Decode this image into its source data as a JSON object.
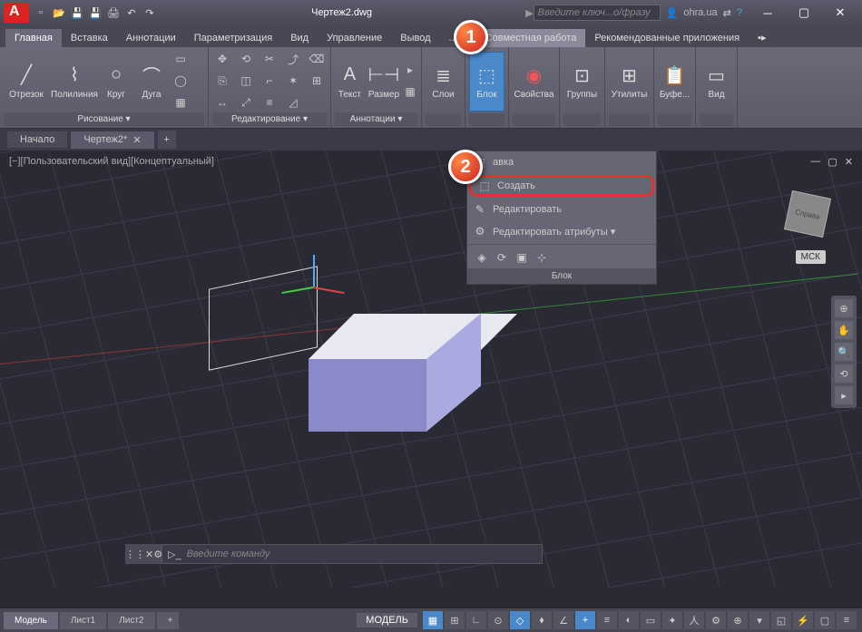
{
  "title": {
    "filename": "Чертеж2.dwg",
    "search_placeholder": "Введите ключ...о/фразу",
    "user": "ohra.ua"
  },
  "menu": {
    "tabs": [
      "Главная",
      "Вставка",
      "Аннотации",
      "Параметризация",
      "Вид",
      "Управление",
      "Вывод",
      "...ки",
      "Совместная работа",
      "Рекомендованные приложения"
    ],
    "active": 0
  },
  "ribbon": {
    "draw": {
      "title": "Рисование ▾",
      "line": "Отрезок",
      "pline": "Полилиния",
      "circle": "Круг",
      "arc": "Дуга"
    },
    "edit": {
      "title": "Редактирование ▾"
    },
    "annot": {
      "title": "Аннотации ▾",
      "text": "Текст",
      "dim": "Размер"
    },
    "layers": {
      "title": "Слои"
    },
    "block": {
      "title": "Блок"
    },
    "props": {
      "title": "Свойства"
    },
    "groups": {
      "title": "Группы"
    },
    "utils": {
      "title": "Утилиты"
    },
    "clip": {
      "title": "Буфе..."
    },
    "view": {
      "title": "Вид"
    }
  },
  "file_tabs": {
    "start": "Начало",
    "f1": "Чертеж2*"
  },
  "viewport": {
    "label": "[−][Пользовательский вид][Концептуальный]",
    "cube": "Справа",
    "msk": "МСК"
  },
  "dropdown": {
    "insert": "авка",
    "create": "Создать",
    "edit": "Редактировать",
    "editattr": "Редактировать атрибуты ▾",
    "panel_title": "Блок"
  },
  "callouts": {
    "one": "1",
    "two": "2"
  },
  "cmdline": {
    "placeholder": "Введите команду"
  },
  "layout": {
    "model": "Модель",
    "l1": "Лист1",
    "l2": "Лист2"
  },
  "status": {
    "model": "МОДЕЛЬ"
  }
}
